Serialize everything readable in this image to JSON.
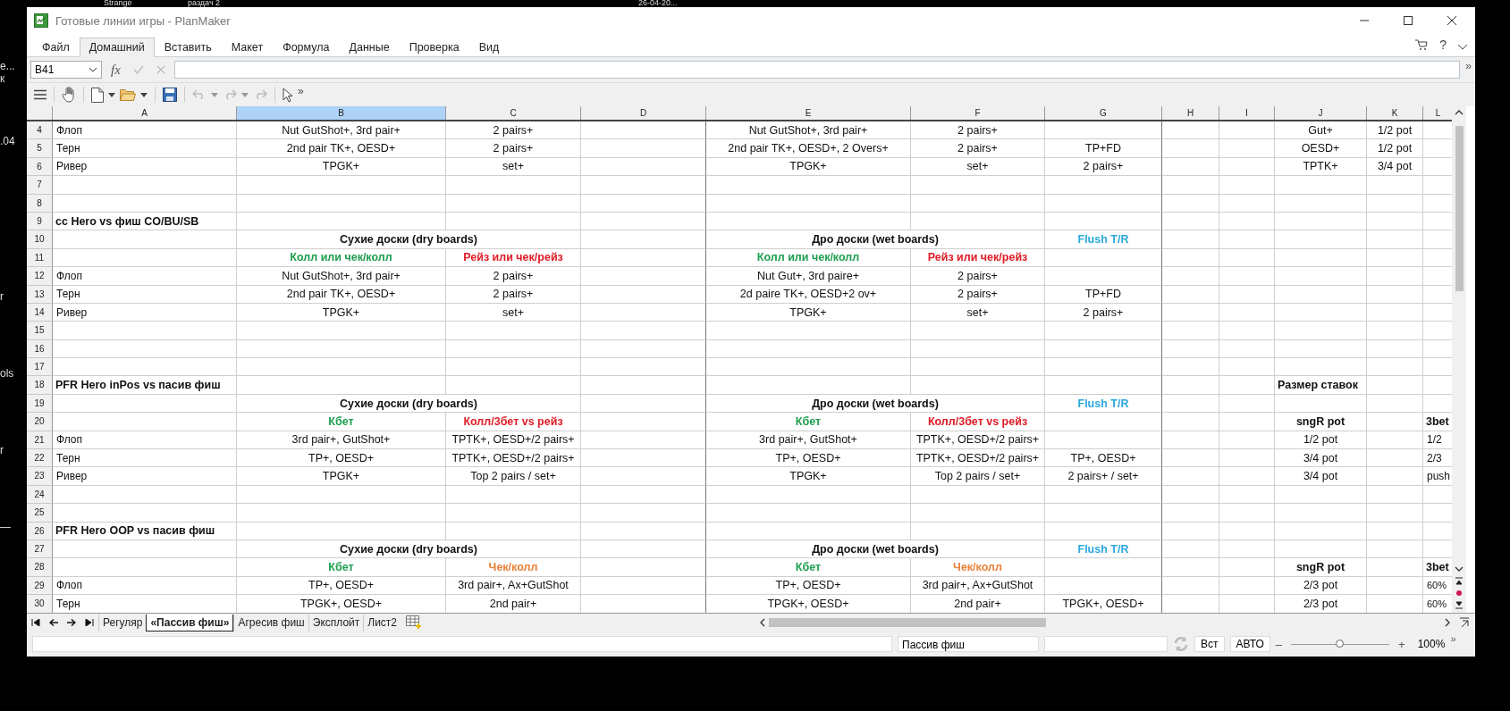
{
  "desktop_fragments": [
    "Strange",
    "раздач 2",
    "26-04-20...",
    "е...",
    "к",
    ".04",
    "r",
    "ols",
    "r",
    "—"
  ],
  "window": {
    "title": "Готовые линии игры - PlanMaker",
    "more": "»"
  },
  "menu": [
    {
      "label": "Файл",
      "selected": false
    },
    {
      "label": "Домашний",
      "selected": true
    },
    {
      "label": "Вставить",
      "selected": false
    },
    {
      "label": "Макет",
      "selected": false
    },
    {
      "label": "Формула",
      "selected": false
    },
    {
      "label": "Данные",
      "selected": false
    },
    {
      "label": "Проверка",
      "selected": false
    },
    {
      "label": "Вид",
      "selected": false
    }
  ],
  "help": "?",
  "formula_bar": {
    "name_box": "B41",
    "fx": "fx",
    "expand": "»"
  },
  "sheet": {
    "columns": [
      {
        "label": "A",
        "selected": false
      },
      {
        "label": "B",
        "selected": true
      },
      {
        "label": "C",
        "selected": false
      },
      {
        "label": "D",
        "selected": false
      },
      {
        "label": "E",
        "selected": false
      },
      {
        "label": "F",
        "selected": false
      },
      {
        "label": "G",
        "selected": false
      },
      {
        "label": "H",
        "selected": false
      },
      {
        "label": "I",
        "selected": false
      },
      {
        "label": "J",
        "selected": false
      },
      {
        "label": "K",
        "selected": false
      },
      {
        "label": "L",
        "selected": false
      }
    ],
    "rows": [
      {
        "number": "4",
        "cells": {
          "A": {
            "text": "Флоп",
            "kind": "label"
          },
          "B": {
            "text": "Nut GutShot+, 3rd pair+",
            "kind": "value"
          },
          "C": {
            "text": "2 pairs+",
            "kind": "value"
          },
          "E": {
            "text": "Nut GutShot+, 3rd pair+",
            "kind": "value"
          },
          "F": {
            "text": "2 pairs+",
            "kind": "value"
          },
          "J": {
            "text": "Gut+",
            "kind": "value"
          },
          "K": {
            "text": "1/2 pot",
            "kind": "value"
          }
        }
      },
      {
        "number": "5",
        "cells": {
          "A": {
            "text": "Терн",
            "kind": "label"
          },
          "B": {
            "text": "2nd pair TK+, OESD+",
            "kind": "value"
          },
          "C": {
            "text": "2 pairs+",
            "kind": "value"
          },
          "E": {
            "text": "2nd pair TK+, OESD+, 2 Overs+",
            "kind": "value"
          },
          "F": {
            "text": "2 pairs+",
            "kind": "value"
          },
          "G": {
            "text": "TP+FD",
            "kind": "value"
          },
          "J": {
            "text": "OESD+",
            "kind": "value"
          },
          "K": {
            "text": "1/2 pot",
            "kind": "value"
          }
        }
      },
      {
        "number": "6",
        "cells": {
          "A": {
            "text": "Ривер",
            "kind": "label"
          },
          "B": {
            "text": "TPGK+",
            "kind": "value"
          },
          "C": {
            "text": "set+",
            "kind": "value"
          },
          "E": {
            "text": "TPGK+",
            "kind": "value"
          },
          "F": {
            "text": "set+",
            "kind": "value"
          },
          "G": {
            "text": "2 pairs+",
            "kind": "value"
          },
          "J": {
            "text": "TPTK+",
            "kind": "value"
          },
          "K": {
            "text": "3/4 pot",
            "kind": "value"
          }
        }
      },
      {
        "number": "7"
      },
      {
        "number": "8"
      },
      {
        "number": "9",
        "cells": {
          "A": {
            "text": "cc Hero vs фиш CO/BU/SB",
            "kind": "title"
          }
        }
      },
      {
        "number": "10",
        "cells": {
          "B": {
            "text": "Сухие доски (dry boards)",
            "kind": "header",
            "merged": true
          },
          "E": {
            "text": "Дро доски (wet boards)",
            "kind": "header",
            "merged": true
          },
          "G": {
            "text": "Flush T/R",
            "kind": "header",
            "color": "#2aa7dd"
          }
        }
      },
      {
        "number": "11",
        "cells": {
          "B": {
            "text": "Колл или чек/колл",
            "kind": "header",
            "color": "#1e9e4f"
          },
          "C": {
            "text": "Рейз или чек/рейз",
            "kind": "header",
            "color": "#e01b24"
          },
          "E": {
            "text": "Колл или чек/колл",
            "kind": "header",
            "color": "#1e9e4f"
          },
          "F": {
            "text": "Рейз или чек/рейз",
            "kind": "header",
            "color": "#e01b24"
          }
        }
      },
      {
        "number": "12",
        "cells": {
          "A": {
            "text": "Флоп",
            "kind": "label"
          },
          "B": {
            "text": "Nut GutShot+, 3rd pair+",
            "kind": "value"
          },
          "C": {
            "text": "2 pairs+",
            "kind": "value"
          },
          "E": {
            "text": "Nut Gut+, 3rd paire+",
            "kind": "value"
          },
          "F": {
            "text": "2 pairs+",
            "kind": "value"
          }
        }
      },
      {
        "number": "13",
        "cells": {
          "A": {
            "text": "Терн",
            "kind": "label"
          },
          "B": {
            "text": "2nd pair TK+, OESD+",
            "kind": "value"
          },
          "C": {
            "text": "2 pairs+",
            "kind": "value"
          },
          "E": {
            "text": "2d paire TK+, OESD+2 ov+",
            "kind": "value"
          },
          "F": {
            "text": "2 pairs+",
            "kind": "value"
          },
          "G": {
            "text": "TP+FD",
            "kind": "value"
          }
        }
      },
      {
        "number": "14",
        "cells": {
          "A": {
            "text": "Ривер",
            "kind": "label"
          },
          "B": {
            "text": "TPGK+",
            "kind": "value"
          },
          "C": {
            "text": "set+",
            "kind": "value"
          },
          "E": {
            "text": "TPGK+",
            "kind": "value"
          },
          "F": {
            "text": "set+",
            "kind": "value"
          },
          "G": {
            "text": "2 pairs+",
            "kind": "value"
          }
        }
      },
      {
        "number": "15"
      },
      {
        "number": "16"
      },
      {
        "number": "17"
      },
      {
        "number": "18",
        "cells": {
          "A": {
            "text": "PFR Hero inPos vs пасив фиш",
            "kind": "title"
          },
          "J": {
            "text": "Размер ставок",
            "kind": "title"
          }
        }
      },
      {
        "number": "19",
        "cells": {
          "B": {
            "text": "Сухие доски (dry boards)",
            "kind": "header",
            "merged": true
          },
          "E": {
            "text": "Дро доски (wet boards)",
            "kind": "header",
            "merged": true
          },
          "G": {
            "text": "Flush T/R",
            "kind": "header",
            "color": "#2aa7dd"
          }
        }
      },
      {
        "number": "20",
        "cells": {
          "B": {
            "text": "Кбет",
            "kind": "header",
            "color": "#1e9e4f"
          },
          "C": {
            "text": "Колл/3бет vs рейз",
            "kind": "header",
            "color": "#e01b24"
          },
          "E": {
            "text": "Кбет",
            "kind": "header",
            "color": "#1e9e4f"
          },
          "F": {
            "text": "Колл/3бет vs рейз",
            "kind": "header",
            "color": "#e01b24"
          },
          "J": {
            "text": "sngR pot",
            "kind": "header"
          },
          "L": {
            "text": "3bet",
            "kind": "title"
          }
        }
      },
      {
        "number": "21",
        "cells": {
          "A": {
            "text": "Флоп",
            "kind": "label"
          },
          "B": {
            "text": "3rd pair+, GutShot+",
            "kind": "value"
          },
          "C": {
            "text": "TPTK+, OESD+/2 pairs+",
            "kind": "value"
          },
          "E": {
            "text": "3rd pair+, GutShot+",
            "kind": "value"
          },
          "F": {
            "text": "TPTK+, OESD+/2 pairs+",
            "kind": "value"
          },
          "J": {
            "text": "1/2 pot",
            "kind": "value"
          },
          "L": {
            "text": "1/2",
            "kind": "label"
          }
        }
      },
      {
        "number": "22",
        "cells": {
          "A": {
            "text": "Терн",
            "kind": "label"
          },
          "B": {
            "text": "TP+, OESD+",
            "kind": "value"
          },
          "C": {
            "text": "TPTK+, OESD+/2 pairs+",
            "kind": "value"
          },
          "E": {
            "text": "TP+, OESD+",
            "kind": "value"
          },
          "F": {
            "text": "TPTK+, OESD+/2 pairs+",
            "kind": "value"
          },
          "G": {
            "text": "TP+, OESD+",
            "kind": "value"
          },
          "J": {
            "text": "3/4 pot",
            "kind": "value"
          },
          "L": {
            "text": "2/3",
            "kind": "label"
          }
        }
      },
      {
        "number": "23",
        "cells": {
          "A": {
            "text": "Ривер",
            "kind": "label"
          },
          "B": {
            "text": "TPGK+",
            "kind": "value"
          },
          "C": {
            "text": "Top 2 pairs / set+",
            "kind": "value"
          },
          "E": {
            "text": "TPGK+",
            "kind": "value"
          },
          "F": {
            "text": "Top 2 pairs / set+",
            "kind": "value"
          },
          "G": {
            "text": "2 pairs+ / set+",
            "kind": "value"
          },
          "J": {
            "text": "3/4 pot",
            "kind": "value"
          },
          "L": {
            "text": "push",
            "kind": "label"
          }
        }
      },
      {
        "number": "24"
      },
      {
        "number": "25"
      },
      {
        "number": "26",
        "cells": {
          "A": {
            "text": "PFR Hero OOP vs пасив фиш",
            "kind": "title"
          }
        }
      },
      {
        "number": "27",
        "cells": {
          "B": {
            "text": "Сухие доски (dry boards)",
            "kind": "header",
            "merged": true
          },
          "E": {
            "text": "Дро доски (wet boards)",
            "kind": "header",
            "merged": true
          },
          "G": {
            "text": "Flush T/R",
            "kind": "header",
            "color": "#2aa7dd"
          }
        }
      },
      {
        "number": "28",
        "cells": {
          "B": {
            "text": "Кбет",
            "kind": "header",
            "color": "#1e9e4f"
          },
          "C": {
            "text": "Чек/колл",
            "kind": "header",
            "color": "#e8823a"
          },
          "E": {
            "text": "Кбет",
            "kind": "header",
            "color": "#1e9e4f"
          },
          "F": {
            "text": "Чек/колл",
            "kind": "header",
            "color": "#e8823a"
          },
          "J": {
            "text": "sngR pot",
            "kind": "header"
          },
          "L": {
            "text": "3bet",
            "kind": "title"
          }
        }
      },
      {
        "number": "29",
        "cells": {
          "A": {
            "text": "Флоп",
            "kind": "label"
          },
          "B": {
            "text": "TP+, OESD+",
            "kind": "value"
          },
          "C": {
            "text": "3rd pair+, Ax+GutShot",
            "kind": "value"
          },
          "E": {
            "text": "TP+, OESD+",
            "kind": "value"
          },
          "F": {
            "text": "3rd pair+, Ax+GutShot",
            "kind": "value"
          },
          "J": {
            "text": "2/3 pot",
            "kind": "value"
          },
          "L": {
            "text": "60%",
            "kind": "small"
          }
        }
      },
      {
        "number": "30",
        "cells": {
          "A": {
            "text": "Терн",
            "kind": "label"
          },
          "B": {
            "text": "TPGK+, OESD+",
            "kind": "value"
          },
          "C": {
            "text": "2nd pair+",
            "kind": "value"
          },
          "E": {
            "text": "TPGK+, OESD+",
            "kind": "value"
          },
          "F": {
            "text": "2nd pair+",
            "kind": "value"
          },
          "G": {
            "text": "TPGK+, OESD+",
            "kind": "value"
          },
          "J": {
            "text": "2/3 pot",
            "kind": "value"
          },
          "L": {
            "text": "60%",
            "kind": "small"
          }
        }
      }
    ]
  },
  "sheet_tabs": [
    {
      "label": "Регуляр",
      "selected": false
    },
    {
      "label": "«Пассив фиш»",
      "selected": true
    },
    {
      "label": "Агресив фиш",
      "selected": false
    },
    {
      "label": "Эксплойт",
      "selected": false
    },
    {
      "label": "Лист2",
      "selected": false
    }
  ],
  "status_bar": {
    "sheet_name": "Пассив фиш",
    "insert_mode": "Вст",
    "calc_mode": "АВТО",
    "zoom": {
      "level": 0.5,
      "value": "100%",
      "minus": "–",
      "plus": "+"
    },
    "more": "»"
  }
}
